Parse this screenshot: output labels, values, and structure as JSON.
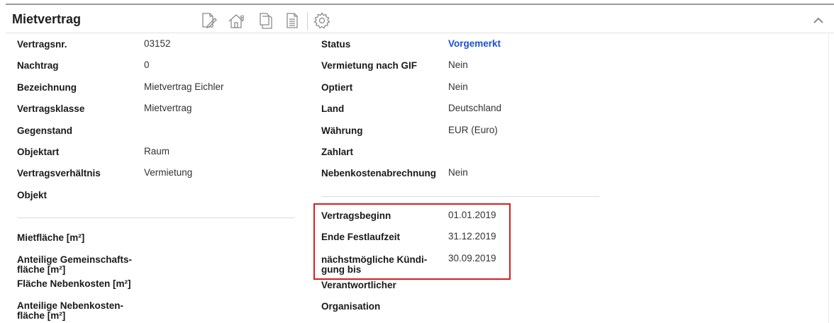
{
  "header": {
    "title": "Mietvertrag"
  },
  "toolbar": {
    "icons": [
      "edit-document-icon",
      "house-euro-icon",
      "copy-icon",
      "document-list-icon",
      "gear-icon"
    ]
  },
  "left": {
    "rows": [
      {
        "label": "Vertragsnr.",
        "value": "03152"
      },
      {
        "label": "Nachtrag",
        "value": "0"
      },
      {
        "label": "Bezeichnung",
        "value": "Mietvertrag Eichler"
      },
      {
        "label": "Vertragsklasse",
        "value": "Mietvertrag"
      },
      {
        "label": "Gegenstand",
        "value": ""
      },
      {
        "label": "Objektart",
        "value": "Raum"
      },
      {
        "label": "Vertragsverhältnis",
        "value": "Vermietung"
      },
      {
        "label": "Objekt",
        "value": ""
      }
    ],
    "area_rows": [
      {
        "label": "Mietfläche [m²]"
      },
      {
        "label_line1": "Anteilige Gemeinschafts-",
        "label_line2": "fläche [m²]"
      },
      {
        "label": "Fläche Nebenkosten [m²]"
      },
      {
        "label_line1": "Anteilige Nebenkosten-",
        "label_line2": "fläche [m²]"
      }
    ]
  },
  "right": {
    "rows": [
      {
        "label": "Status",
        "value": "Vorgemerkt"
      },
      {
        "label": "Vermietung nach GIF",
        "value": "Nein"
      },
      {
        "label": "Optiert",
        "value": "Nein"
      },
      {
        "label": "Land",
        "value": "Deutschland"
      },
      {
        "label": "Währung",
        "value": "EUR (Euro)"
      },
      {
        "label": "Zahlart",
        "value": ""
      },
      {
        "label": "Nebenkostenabrechnung",
        "value": "Nein"
      }
    ],
    "date_rows": [
      {
        "label": "Vertragsbeginn",
        "value": "01.01.2019"
      },
      {
        "label": "Ende Festlaufzeit",
        "value": "31.12.2019"
      },
      {
        "label_line1": "nächstmögliche Kündi-",
        "label_line2": "gung bis",
        "value": "30.09.2019"
      }
    ],
    "extra_rows": [
      {
        "label": "Verantwortlicher"
      },
      {
        "label": "Organisation"
      }
    ]
  },
  "colors": {
    "status": "#1d4fd6",
    "highlight": "#d42020"
  }
}
